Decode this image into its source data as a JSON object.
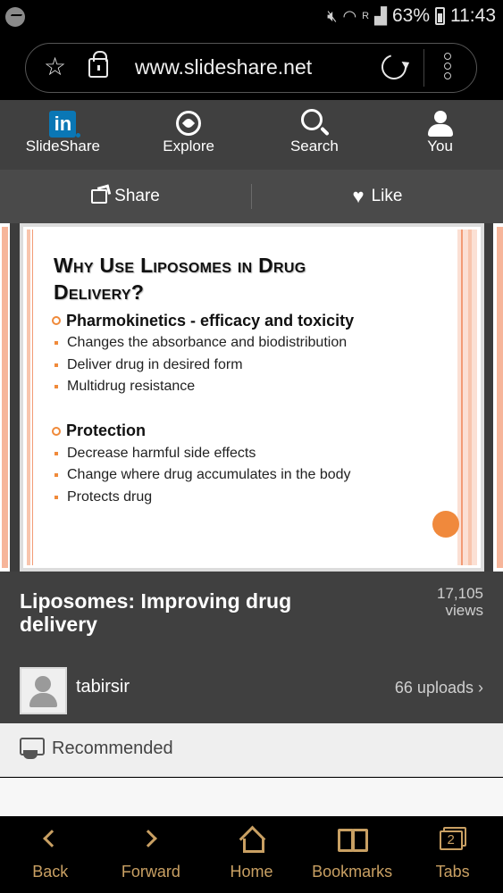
{
  "status_bar": {
    "battery": "63%",
    "time": "11:43",
    "signal_badge": "R"
  },
  "browser": {
    "url": "www.slideshare.net"
  },
  "ss_nav": {
    "items": [
      {
        "label": "SlideShare",
        "logo": "in"
      },
      {
        "label": "Explore"
      },
      {
        "label": "Search"
      },
      {
        "label": "You"
      }
    ]
  },
  "actions": {
    "share": "Share",
    "like": "Like"
  },
  "slide": {
    "title_line1": "Why Use Liposomes in Drug",
    "title_line2": "Delivery?",
    "section1": {
      "heading": "Pharmokinetics - efficacy and toxicity",
      "bullets": [
        "Changes the absorbance and biodistribution",
        "Deliver drug in desired form",
        "Multidrug resistance"
      ]
    },
    "section2": {
      "heading": "Protection",
      "bullets": [
        "Decrease harmful side effects",
        "Change where drug accumulates in the body",
        "Protects drug"
      ]
    }
  },
  "document": {
    "title": "Liposomes: Improving drug delivery",
    "views_count": "17,105",
    "views_label": "views",
    "uploader": "tabirsir",
    "uploads": "66 uploads"
  },
  "recommended": {
    "label": "Recommended"
  },
  "bottom_bar": {
    "items": [
      {
        "label": "Back"
      },
      {
        "label": "Forward"
      },
      {
        "label": "Home"
      },
      {
        "label": "Bookmarks"
      },
      {
        "label": "Tabs",
        "count": "2"
      }
    ]
  },
  "colors": {
    "accent_gold": "#c9a063",
    "slide_orange": "#f0893c",
    "linkedin_blue": "#0a77b5"
  }
}
